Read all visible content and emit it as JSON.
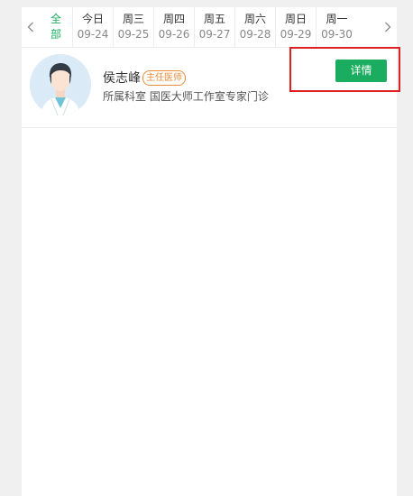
{
  "date_bar": {
    "all_tab_label": "全部",
    "days": [
      {
        "name": "今日",
        "date": "09-24"
      },
      {
        "name": "周三",
        "date": "09-25"
      },
      {
        "name": "周四",
        "date": "09-26"
      },
      {
        "name": "周五",
        "date": "09-27"
      },
      {
        "name": "周六",
        "date": "09-28"
      },
      {
        "name": "周日",
        "date": "09-29"
      },
      {
        "name": "周一",
        "date": "09-30"
      }
    ],
    "prev_icon": "chevron-left-icon",
    "next_icon": "chevron-right-icon"
  },
  "doctor": {
    "name": "侯志峰",
    "title_badge": "主任医师",
    "department": "所属科室 国医大师工作室专家门诊",
    "detail_button_label": "详情"
  },
  "colors": {
    "accent_green": "#1aad5f",
    "badge_orange": "#e98b3a",
    "highlight_red": "#e02020"
  }
}
